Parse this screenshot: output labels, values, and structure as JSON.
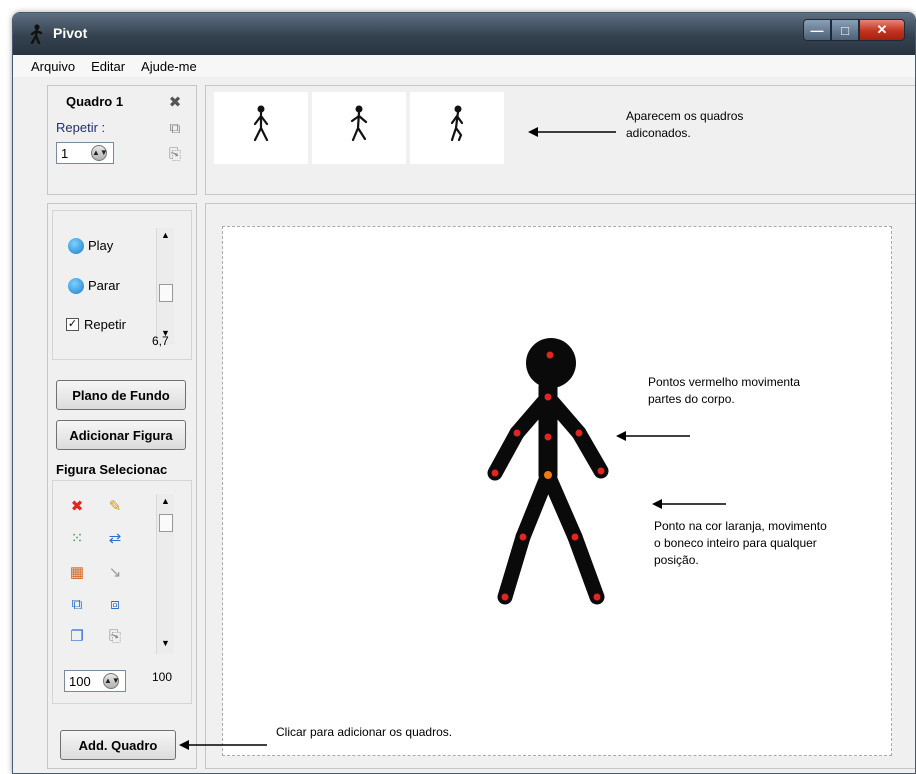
{
  "window": {
    "title": "Pivot",
    "minimize": "—",
    "maximize": "□",
    "close": "✕"
  },
  "menu": {
    "items": [
      "Arquivo",
      "Editar",
      "Ajude-me"
    ]
  },
  "frame_info": {
    "frame_label": "Quadro 1",
    "repeat_label": "Repetir :",
    "repeat_value": "1"
  },
  "frames_strip": {
    "thumbnails": [
      "frame-1",
      "frame-2",
      "frame-3"
    ],
    "annotation": "Aparecem os quadros adiconados."
  },
  "playback": {
    "play_label": "Play",
    "stop_label": "Parar",
    "repeat_label": "Repetir",
    "repeat_checked": true,
    "speed_value": "6,7"
  },
  "buttons": {
    "background": "Plano de Fundo",
    "add_figure": "Adicionar Figura",
    "add_frame": "Add. Quadro"
  },
  "figure": {
    "selected_label": "Figura Selecionac",
    "size_value": "100",
    "scale_value": "100",
    "tool_icons": [
      "delete-icon",
      "edit-pencil-icon",
      "center-icon",
      "flip-icon",
      "color-icon",
      "segment-icon",
      "bring-front-icon",
      "send-back-icon",
      "copy-icon",
      "paste-icon"
    ]
  },
  "canvas_annotations": {
    "red_points": "Pontos vermelho movimenta partes do corpo.",
    "orange_point": "Ponto na cor laranja, movimento o boneco inteiro para qualquer posição.",
    "add_frame": "Clicar para adicionar os quadros."
  },
  "colors": {
    "joint_red": "#e0261f",
    "joint_orange": "#f07a12",
    "figure": "#0a0a0a",
    "titlebar": "#34424f"
  }
}
